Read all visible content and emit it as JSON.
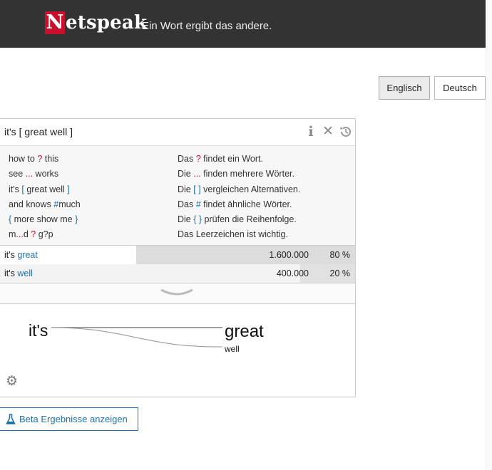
{
  "header": {
    "logo_first": "N",
    "logo_rest": "etspeak",
    "slogan": "Ein Wort ergibt das andere."
  },
  "languages": [
    {
      "label": "Englisch",
      "selected": true
    },
    {
      "label": "Deutsch",
      "selected": false
    }
  ],
  "query": {
    "value": "it's [ great well ]"
  },
  "toolbar_icons": [
    "info-icon",
    "clear-icon",
    "history-icon"
  ],
  "help": {
    "examples": [
      {
        "pre": "how to ",
        "op": "?",
        "post": " this"
      },
      {
        "pre": "see ",
        "op": "...",
        "post": " works"
      },
      {
        "pre": "it's ",
        "op": "[",
        "mid": " great well ",
        "op2": "]",
        "post": ""
      },
      {
        "pre": "and knows ",
        "op": "#",
        "post": "much"
      },
      {
        "pre": "",
        "op": "{",
        "mid": " more show me ",
        "op2": "}",
        "post": ""
      },
      {
        "pre": "m",
        "op": "...",
        "mid": "d ",
        "op2": "?",
        "post": " g?p"
      }
    ],
    "descriptions": [
      {
        "pre": "Das ",
        "op": "?",
        "post": " findet ein Wort."
      },
      {
        "pre": "Die ",
        "op": "...",
        "post": " finden mehrere Wörter."
      },
      {
        "pre": "Die ",
        "op": "[ ]",
        "post": " vergleichen Alternativen."
      },
      {
        "pre": "Das ",
        "op": "#",
        "post": " findet ähnliche Wörter."
      },
      {
        "pre": "Die ",
        "op": "{ }",
        "post": " prüfen die Reihenfolge."
      },
      {
        "pre": "Das Leerzeichen ist wichtig.",
        "op": "",
        "post": ""
      }
    ]
  },
  "results": [
    {
      "prefix": "it's ",
      "word": "great",
      "frequency": "1.600.000",
      "percent": "80 %",
      "share": 0.8
    },
    {
      "prefix": "it's ",
      "word": "well",
      "frequency": "400.000",
      "percent": "20 %",
      "share": 0.2
    }
  ],
  "graph": {
    "root": "it's",
    "main": "great",
    "alt": "well"
  },
  "beta": {
    "label": "Beta Ergebnisse anzeigen"
  },
  "colors": {
    "brand_red": "#c8102e",
    "header_bg": "#333333",
    "accent_blue": "#1e6fa8"
  }
}
